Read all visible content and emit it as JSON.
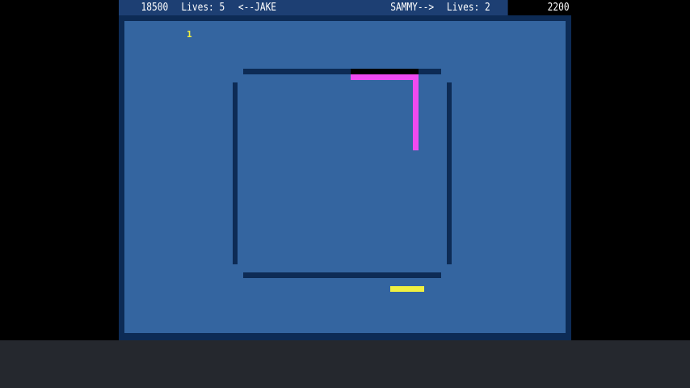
{
  "hud": {
    "player1_score": "18500",
    "player1_lives": "Lives: 5",
    "player1_name": "<--JAKE",
    "player2_name": "SAMMY-->",
    "player2_lives": "Lives: 2",
    "player2_score": "2200"
  },
  "food": {
    "value": "1"
  },
  "colors": {
    "background": "#3465a0",
    "walls": "#0d2b55",
    "snake_jake": "#f04af0",
    "snake_sammy": "#f0f040",
    "hud_bar": "#1d3f73"
  }
}
